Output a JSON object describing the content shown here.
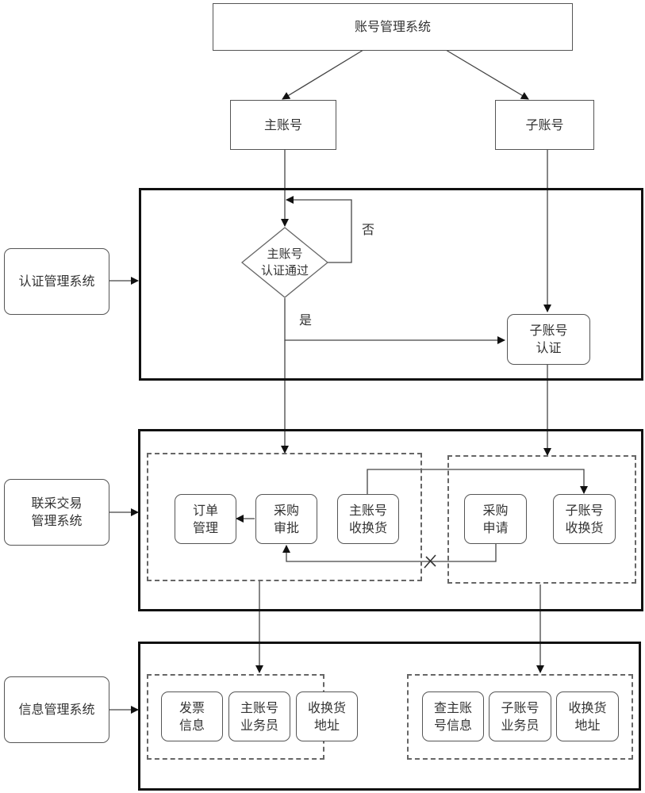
{
  "title": "账号管理系统",
  "accounts": {
    "main": "主账号",
    "sub": "子账号"
  },
  "systems": {
    "auth": "认证管理系统",
    "trade": [
      "联采交易",
      "管理系统"
    ],
    "info": "信息管理系统"
  },
  "auth": {
    "decision": [
      "主账号",
      "认证通过"
    ],
    "no_label": "否",
    "yes_label": "是",
    "sub_auth": [
      "子账号",
      "认证"
    ]
  },
  "trade": {
    "main_group": [
      {
        "id": "order",
        "lines": [
          "订单",
          "管理"
        ]
      },
      {
        "id": "approve",
        "lines": [
          "采购",
          "审批"
        ]
      },
      {
        "id": "main-receive",
        "lines": [
          "主账号",
          "收换货"
        ]
      }
    ],
    "sub_group": [
      {
        "id": "apply",
        "lines": [
          "采购",
          "申请"
        ]
      },
      {
        "id": "sub-receive",
        "lines": [
          "子账号",
          "收换货"
        ]
      }
    ]
  },
  "info": {
    "main_group": [
      {
        "id": "invoice",
        "lines": [
          "发票",
          "信息"
        ]
      },
      {
        "id": "main-staff",
        "lines": [
          "主账号",
          "业务员"
        ]
      },
      {
        "id": "main-address",
        "lines": [
          "收换货",
          "地址"
        ]
      }
    ],
    "sub_group": [
      {
        "id": "query-main",
        "lines": [
          "查主账",
          "号信息"
        ]
      },
      {
        "id": "sub-staff",
        "lines": [
          "子账号",
          "业务员"
        ]
      },
      {
        "id": "sub-address",
        "lines": [
          "收换货",
          "地址"
        ]
      }
    ]
  }
}
